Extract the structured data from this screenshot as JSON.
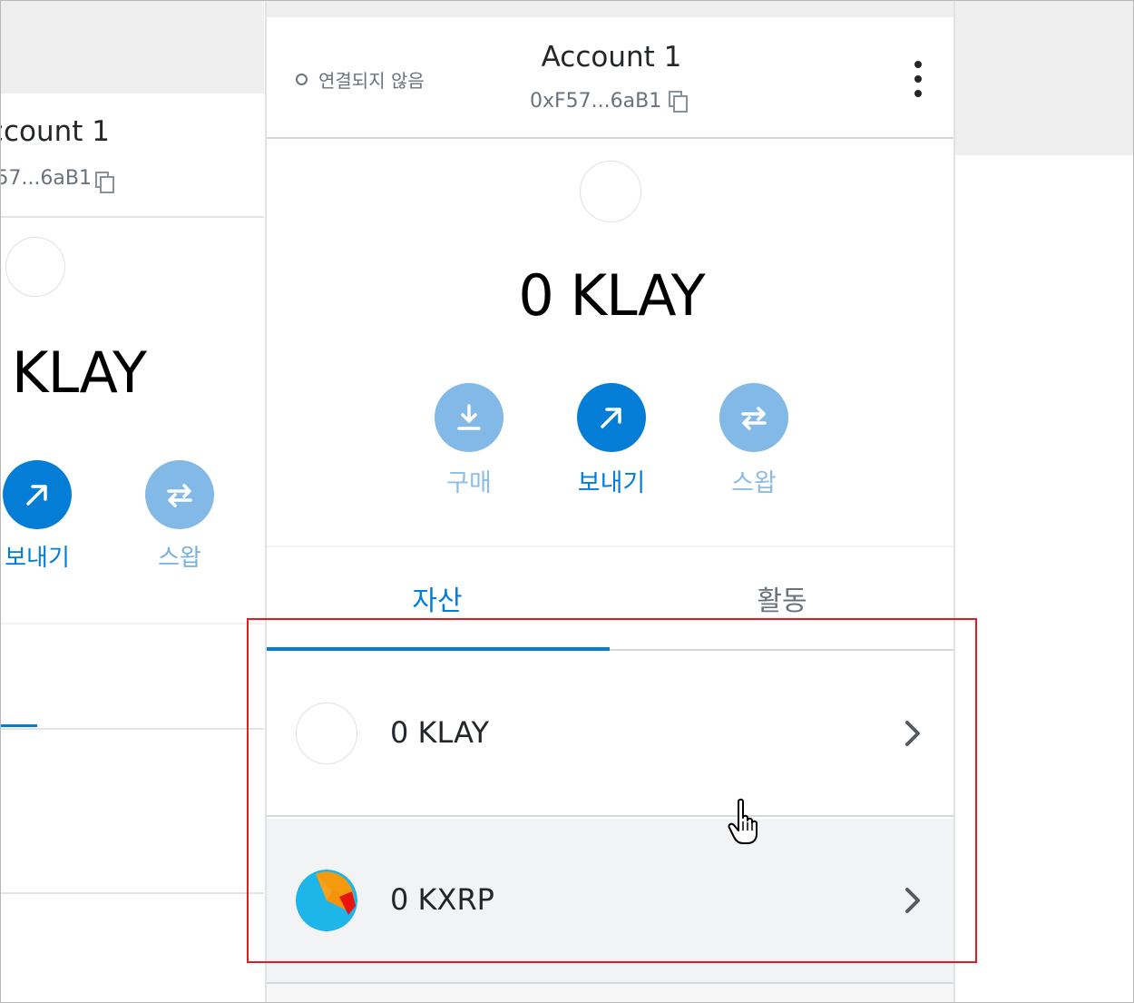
{
  "left_panel": {
    "account_name": "ccount 1",
    "address": "57...6aB1",
    "balance": "KLAY",
    "send_label": "보내기",
    "swap_label": "스왑"
  },
  "header": {
    "connection_status": "연결되지 않음",
    "account_name": "Account 1",
    "address": "0xF57...6aB1"
  },
  "balance": {
    "display": "0 KLAY"
  },
  "actions": {
    "buy_label": "구매",
    "send_label": "보내기",
    "swap_label": "스왑"
  },
  "tabs": [
    {
      "label": "자산",
      "active": true
    },
    {
      "label": "활동",
      "active": false
    }
  ],
  "assets": [
    {
      "label": "0 KLAY",
      "icon": "empty-token-icon"
    },
    {
      "label": "0 KXRP",
      "icon": "kxrp-token-icon"
    }
  ],
  "colors": {
    "primary": "#037dd6",
    "primary_light": "#83b9e6",
    "highlight": "#e31b23"
  }
}
